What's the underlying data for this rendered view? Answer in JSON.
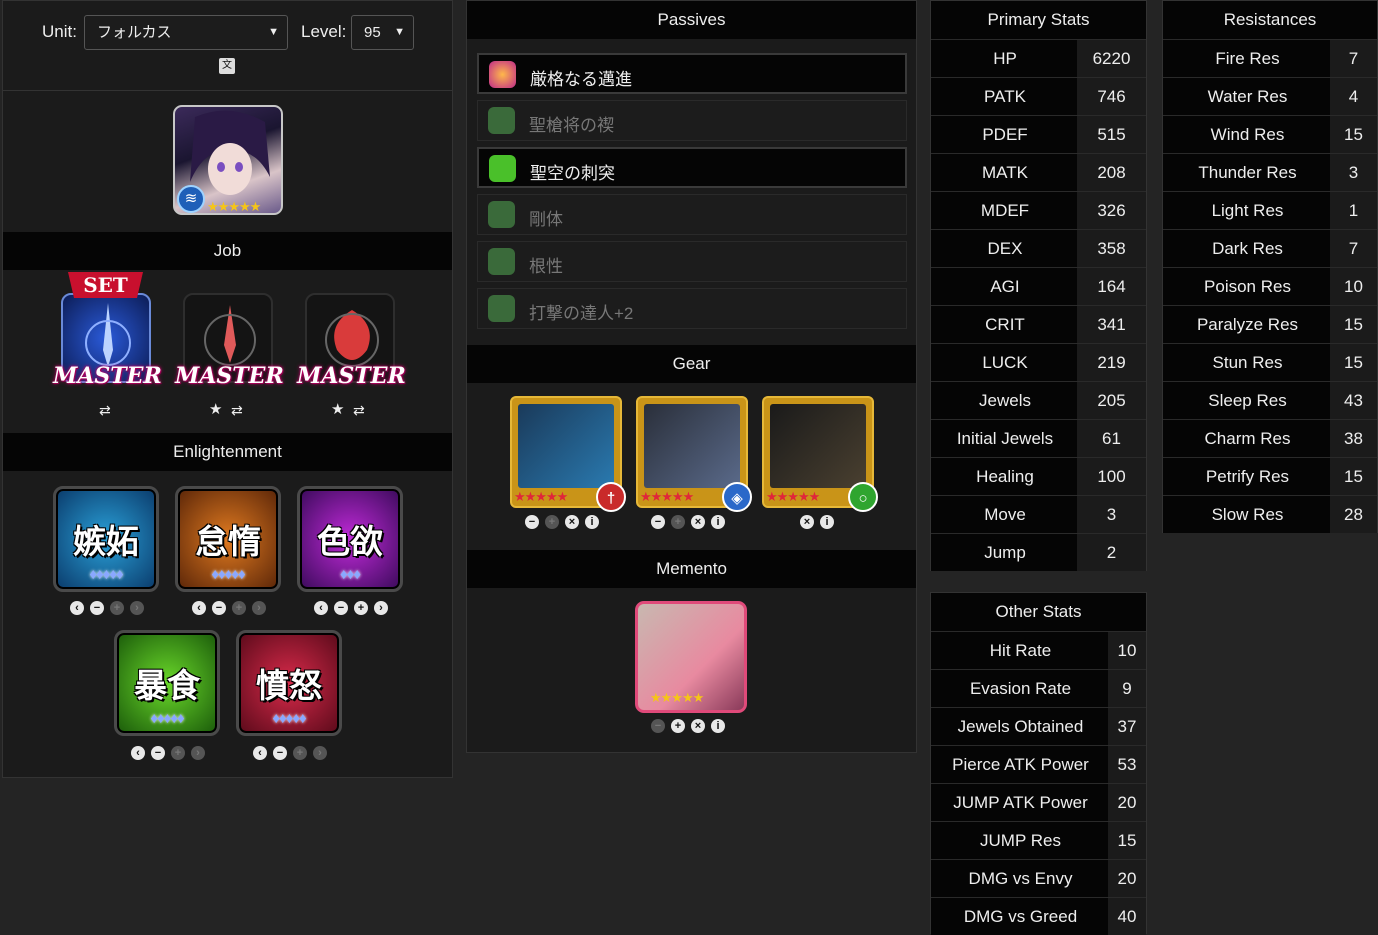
{
  "header": {
    "unit_label": "Unit:",
    "unit_value": "フォルカス",
    "level_label": "Level:",
    "level_value": "95",
    "translate_icon": "translate-icon"
  },
  "unit_portrait": {
    "stars": "★★★★★",
    "element": "water"
  },
  "job": {
    "title": "Job",
    "set_badge": "SET",
    "master_label": "MASTER",
    "jobs": [
      {
        "icon": "lance-job-icon"
      },
      {
        "icon": "sword-job-icon"
      },
      {
        "icon": "demon-job-icon"
      }
    ]
  },
  "enlightenment": {
    "title": "Enlightenment",
    "items": [
      {
        "kanji": "嫉妬",
        "gems": "♦♦♦♦♦"
      },
      {
        "kanji": "怠惰",
        "gems": "♦♦♦♦♦"
      },
      {
        "kanji": "色欲",
        "gems": "♦♦♦"
      },
      {
        "kanji": "暴食",
        "gems": "♦♦♦♦♦"
      },
      {
        "kanji": "憤怒",
        "gems": "♦♦♦♦♦"
      }
    ]
  },
  "passives": {
    "title": "Passives",
    "items": [
      {
        "name": "厳格なる邁進",
        "active": true
      },
      {
        "name": "聖槍将の禊",
        "active": false
      },
      {
        "name": "聖空の刺突",
        "active": true
      },
      {
        "name": "剛体",
        "active": false
      },
      {
        "name": "根性",
        "active": false
      },
      {
        "name": "打撃の達人+2",
        "active": false
      }
    ]
  },
  "gear": {
    "title": "Gear",
    "items": [
      {
        "icon": "spear-icon",
        "stars": "★★★★★",
        "badge": "sword-badge-icon",
        "color": "#c92a2a"
      },
      {
        "icon": "gauntlet-icon",
        "stars": "★★★★★",
        "badge": "shield-badge-icon",
        "color": "#2a68c9"
      },
      {
        "icon": "necklace-icon",
        "stars": "★★★★★",
        "badge": "ring-badge-icon",
        "color": "#2fa52f"
      }
    ]
  },
  "memento": {
    "title": "Memento",
    "stars": "★★★★★"
  },
  "primary_stats": {
    "title": "Primary Stats",
    "rows": [
      {
        "name": "HP",
        "value": "6220"
      },
      {
        "name": "PATK",
        "value": "746"
      },
      {
        "name": "PDEF",
        "value": "515"
      },
      {
        "name": "MATK",
        "value": "208"
      },
      {
        "name": "MDEF",
        "value": "326"
      },
      {
        "name": "DEX",
        "value": "358"
      },
      {
        "name": "AGI",
        "value": "164"
      },
      {
        "name": "CRIT",
        "value": "341"
      },
      {
        "name": "LUCK",
        "value": "219"
      },
      {
        "name": "Jewels",
        "value": "205"
      },
      {
        "name": "Initial Jewels",
        "value": "61"
      },
      {
        "name": "Healing",
        "value": "100"
      },
      {
        "name": "Move",
        "value": "3"
      },
      {
        "name": "Jump",
        "value": "2"
      }
    ]
  },
  "other_stats": {
    "title": "Other Stats",
    "rows": [
      {
        "name": "Hit Rate",
        "value": "10"
      },
      {
        "name": "Evasion Rate",
        "value": "9"
      },
      {
        "name": "Jewels Obtained",
        "value": "37"
      },
      {
        "name": "Pierce ATK Power",
        "value": "53"
      },
      {
        "name": "JUMP ATK Power",
        "value": "20"
      },
      {
        "name": "JUMP Res",
        "value": "15"
      },
      {
        "name": "DMG vs Envy",
        "value": "20"
      },
      {
        "name": "DMG vs Greed",
        "value": "40"
      }
    ]
  },
  "resistances": {
    "title": "Resistances",
    "rows": [
      {
        "name": "Fire Res",
        "value": "7"
      },
      {
        "name": "Water Res",
        "value": "4"
      },
      {
        "name": "Wind Res",
        "value": "15"
      },
      {
        "name": "Thunder Res",
        "value": "3"
      },
      {
        "name": "Light Res",
        "value": "1"
      },
      {
        "name": "Dark Res",
        "value": "7"
      },
      {
        "name": "Poison Res",
        "value": "10"
      },
      {
        "name": "Paralyze Res",
        "value": "15"
      },
      {
        "name": "Stun Res",
        "value": "15"
      },
      {
        "name": "Sleep Res",
        "value": "43"
      },
      {
        "name": "Charm Res",
        "value": "38"
      },
      {
        "name": "Petrify Res",
        "value": "15"
      },
      {
        "name": "Slow Res",
        "value": "28"
      }
    ]
  }
}
